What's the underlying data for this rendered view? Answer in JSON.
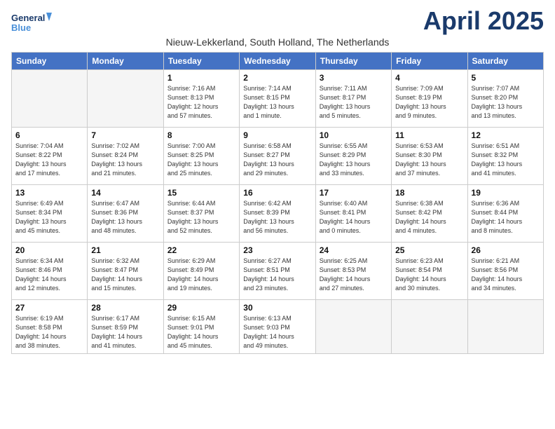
{
  "logo": {
    "line1": "General",
    "line2": "Blue"
  },
  "title": "April 2025",
  "subtitle": "Nieuw-Lekkerland, South Holland, The Netherlands",
  "weekdays": [
    "Sunday",
    "Monday",
    "Tuesday",
    "Wednesday",
    "Thursday",
    "Friday",
    "Saturday"
  ],
  "weeks": [
    [
      {
        "day": "",
        "info": ""
      },
      {
        "day": "",
        "info": ""
      },
      {
        "day": "1",
        "info": "Sunrise: 7:16 AM\nSunset: 8:13 PM\nDaylight: 12 hours\nand 57 minutes."
      },
      {
        "day": "2",
        "info": "Sunrise: 7:14 AM\nSunset: 8:15 PM\nDaylight: 13 hours\nand 1 minute."
      },
      {
        "day": "3",
        "info": "Sunrise: 7:11 AM\nSunset: 8:17 PM\nDaylight: 13 hours\nand 5 minutes."
      },
      {
        "day": "4",
        "info": "Sunrise: 7:09 AM\nSunset: 8:19 PM\nDaylight: 13 hours\nand 9 minutes."
      },
      {
        "day": "5",
        "info": "Sunrise: 7:07 AM\nSunset: 8:20 PM\nDaylight: 13 hours\nand 13 minutes."
      }
    ],
    [
      {
        "day": "6",
        "info": "Sunrise: 7:04 AM\nSunset: 8:22 PM\nDaylight: 13 hours\nand 17 minutes."
      },
      {
        "day": "7",
        "info": "Sunrise: 7:02 AM\nSunset: 8:24 PM\nDaylight: 13 hours\nand 21 minutes."
      },
      {
        "day": "8",
        "info": "Sunrise: 7:00 AM\nSunset: 8:25 PM\nDaylight: 13 hours\nand 25 minutes."
      },
      {
        "day": "9",
        "info": "Sunrise: 6:58 AM\nSunset: 8:27 PM\nDaylight: 13 hours\nand 29 minutes."
      },
      {
        "day": "10",
        "info": "Sunrise: 6:55 AM\nSunset: 8:29 PM\nDaylight: 13 hours\nand 33 minutes."
      },
      {
        "day": "11",
        "info": "Sunrise: 6:53 AM\nSunset: 8:30 PM\nDaylight: 13 hours\nand 37 minutes."
      },
      {
        "day": "12",
        "info": "Sunrise: 6:51 AM\nSunset: 8:32 PM\nDaylight: 13 hours\nand 41 minutes."
      }
    ],
    [
      {
        "day": "13",
        "info": "Sunrise: 6:49 AM\nSunset: 8:34 PM\nDaylight: 13 hours\nand 45 minutes."
      },
      {
        "day": "14",
        "info": "Sunrise: 6:47 AM\nSunset: 8:36 PM\nDaylight: 13 hours\nand 48 minutes."
      },
      {
        "day": "15",
        "info": "Sunrise: 6:44 AM\nSunset: 8:37 PM\nDaylight: 13 hours\nand 52 minutes."
      },
      {
        "day": "16",
        "info": "Sunrise: 6:42 AM\nSunset: 8:39 PM\nDaylight: 13 hours\nand 56 minutes."
      },
      {
        "day": "17",
        "info": "Sunrise: 6:40 AM\nSunset: 8:41 PM\nDaylight: 14 hours\nand 0 minutes."
      },
      {
        "day": "18",
        "info": "Sunrise: 6:38 AM\nSunset: 8:42 PM\nDaylight: 14 hours\nand 4 minutes."
      },
      {
        "day": "19",
        "info": "Sunrise: 6:36 AM\nSunset: 8:44 PM\nDaylight: 14 hours\nand 8 minutes."
      }
    ],
    [
      {
        "day": "20",
        "info": "Sunrise: 6:34 AM\nSunset: 8:46 PM\nDaylight: 14 hours\nand 12 minutes."
      },
      {
        "day": "21",
        "info": "Sunrise: 6:32 AM\nSunset: 8:47 PM\nDaylight: 14 hours\nand 15 minutes."
      },
      {
        "day": "22",
        "info": "Sunrise: 6:29 AM\nSunset: 8:49 PM\nDaylight: 14 hours\nand 19 minutes."
      },
      {
        "day": "23",
        "info": "Sunrise: 6:27 AM\nSunset: 8:51 PM\nDaylight: 14 hours\nand 23 minutes."
      },
      {
        "day": "24",
        "info": "Sunrise: 6:25 AM\nSunset: 8:53 PM\nDaylight: 14 hours\nand 27 minutes."
      },
      {
        "day": "25",
        "info": "Sunrise: 6:23 AM\nSunset: 8:54 PM\nDaylight: 14 hours\nand 30 minutes."
      },
      {
        "day": "26",
        "info": "Sunrise: 6:21 AM\nSunset: 8:56 PM\nDaylight: 14 hours\nand 34 minutes."
      }
    ],
    [
      {
        "day": "27",
        "info": "Sunrise: 6:19 AM\nSunset: 8:58 PM\nDaylight: 14 hours\nand 38 minutes."
      },
      {
        "day": "28",
        "info": "Sunrise: 6:17 AM\nSunset: 8:59 PM\nDaylight: 14 hours\nand 41 minutes."
      },
      {
        "day": "29",
        "info": "Sunrise: 6:15 AM\nSunset: 9:01 PM\nDaylight: 14 hours\nand 45 minutes."
      },
      {
        "day": "30",
        "info": "Sunrise: 6:13 AM\nSunset: 9:03 PM\nDaylight: 14 hours\nand 49 minutes."
      },
      {
        "day": "",
        "info": ""
      },
      {
        "day": "",
        "info": ""
      },
      {
        "day": "",
        "info": ""
      }
    ]
  ]
}
